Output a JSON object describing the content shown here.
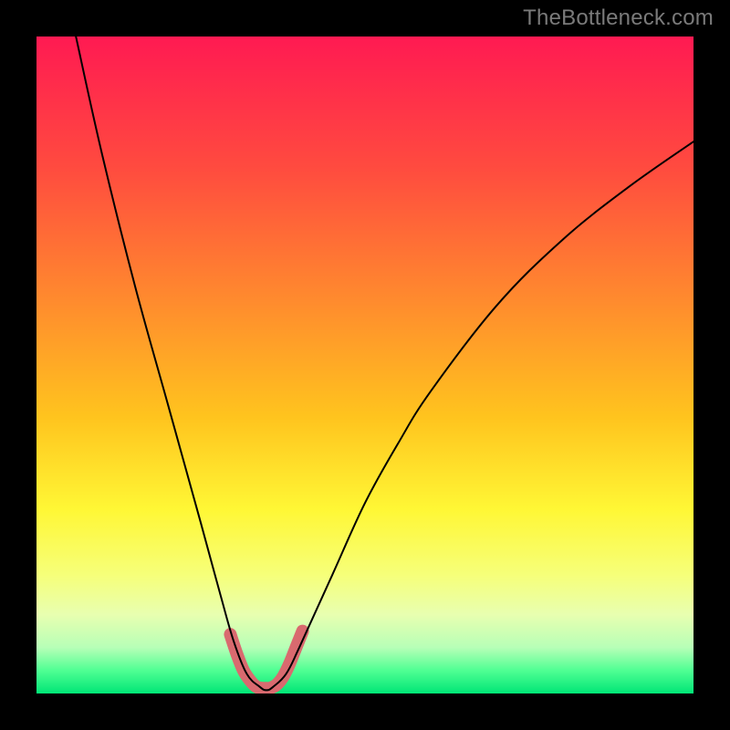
{
  "watermark": "TheBottleneck.com",
  "chart_data": {
    "type": "line",
    "title": "",
    "xlabel": "",
    "ylabel": "",
    "xlim": [
      0,
      100
    ],
    "ylim": [
      0,
      100
    ],
    "grid": false,
    "legend": false,
    "series": [
      {
        "name": "bottleneck-curve",
        "x": [
          6,
          10,
          15,
          20,
          25,
          28,
          30,
          32,
          34,
          35,
          36,
          38,
          40,
          45,
          50,
          55,
          60,
          70,
          80,
          90,
          100
        ],
        "y": [
          100,
          82,
          62,
          44,
          26,
          15,
          8,
          3,
          1,
          0.5,
          1,
          3,
          7,
          18,
          29,
          38,
          46,
          59,
          69,
          77,
          84
        ],
        "color": "#000000",
        "stroke_width": 2
      }
    ],
    "highlight": {
      "name": "optimal-range-marker",
      "x": [
        29.5,
        30.5,
        31.5,
        32.5,
        33.5,
        34.5,
        35,
        35.5,
        36.5,
        37.5,
        38.5,
        39.5,
        40.5
      ],
      "y": [
        9,
        6,
        3.5,
        2,
        1,
        0.8,
        0.8,
        0.8,
        1.3,
        2.5,
        4.5,
        7,
        9.5
      ],
      "color": "#d96a6f",
      "stroke_width": 14
    },
    "background_gradient": {
      "stops": [
        {
          "offset": 0.0,
          "color": "#ff1a52"
        },
        {
          "offset": 0.2,
          "color": "#ff4b3f"
        },
        {
          "offset": 0.4,
          "color": "#ff8a2e"
        },
        {
          "offset": 0.58,
          "color": "#ffc41e"
        },
        {
          "offset": 0.72,
          "color": "#fff735"
        },
        {
          "offset": 0.82,
          "color": "#f6ff7a"
        },
        {
          "offset": 0.88,
          "color": "#e8ffb0"
        },
        {
          "offset": 0.93,
          "color": "#b7ffb7"
        },
        {
          "offset": 0.965,
          "color": "#4fff93"
        },
        {
          "offset": 1.0,
          "color": "#00e676"
        }
      ]
    }
  }
}
